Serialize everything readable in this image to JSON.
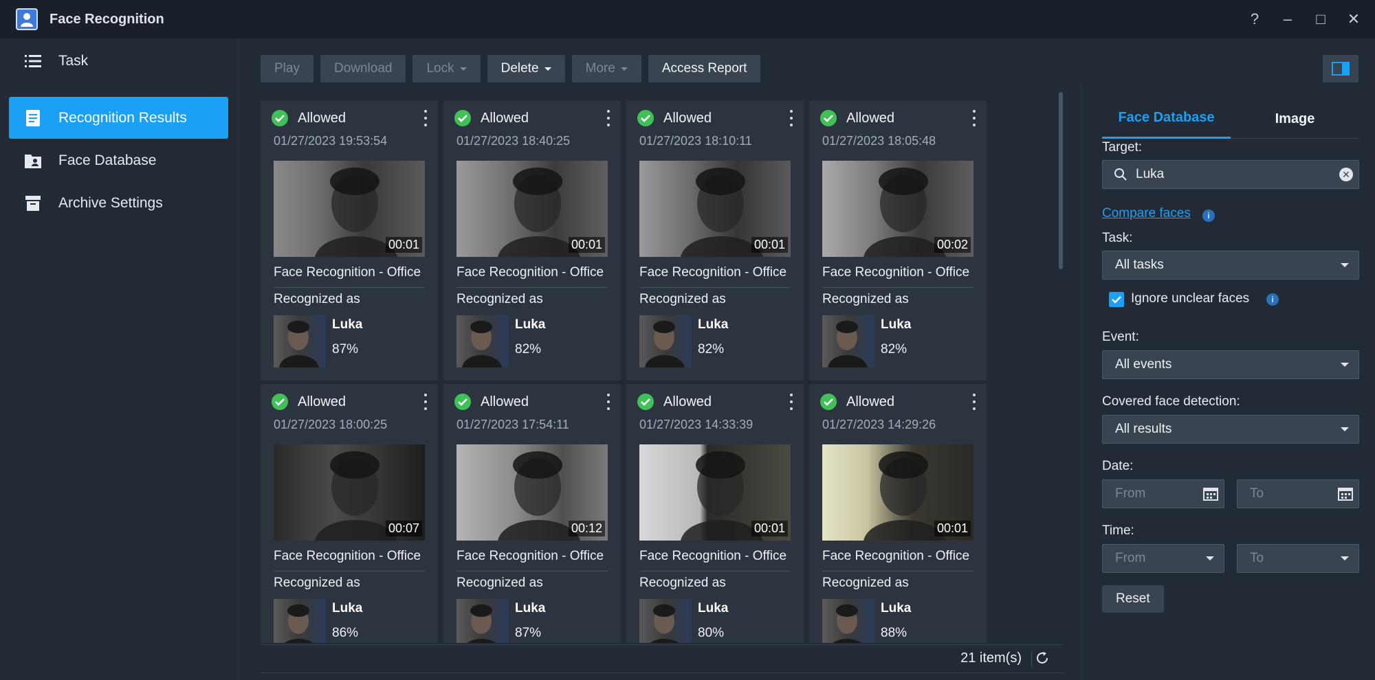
{
  "window": {
    "title": "Face Recognition",
    "controls": [
      "?",
      "–",
      "□",
      "✕"
    ]
  },
  "sidebar": {
    "items": [
      {
        "label": "Task",
        "icon": "list-icon",
        "active": false
      },
      {
        "label": "Recognition Results",
        "icon": "document-icon",
        "active": true
      },
      {
        "label": "Face Database",
        "icon": "folder-user-icon",
        "active": false
      },
      {
        "label": "Archive Settings",
        "icon": "archive-box-icon",
        "active": false
      }
    ]
  },
  "toolbar": {
    "play": "Play",
    "download": "Download",
    "lock": "Lock",
    "delete": "Delete",
    "more": "More",
    "access_report": "Access Report"
  },
  "results": [
    {
      "status": "Allowed",
      "time": "01/27/2023 19:53:54",
      "duration": "00:01",
      "task": "Face Recognition - Office",
      "recognized_label": "Recognized as",
      "name": "Luka",
      "score": "87%"
    },
    {
      "status": "Allowed",
      "time": "01/27/2023 18:40:25",
      "duration": "00:01",
      "task": "Face Recognition - Office",
      "recognized_label": "Recognized as",
      "name": "Luka",
      "score": "82%"
    },
    {
      "status": "Allowed",
      "time": "01/27/2023 18:10:11",
      "duration": "00:01",
      "task": "Face Recognition - Office",
      "recognized_label": "Recognized as",
      "name": "Luka",
      "score": "82%"
    },
    {
      "status": "Allowed",
      "time": "01/27/2023 18:05:48",
      "duration": "00:02",
      "task": "Face Recognition - Office",
      "recognized_label": "Recognized as",
      "name": "Luka",
      "score": "82%"
    },
    {
      "status": "Allowed",
      "time": "01/27/2023 18:00:25",
      "duration": "00:07",
      "task": "Face Recognition - Office",
      "recognized_label": "Recognized as",
      "name": "Luka",
      "score": "86%"
    },
    {
      "status": "Allowed",
      "time": "01/27/2023 17:54:11",
      "duration": "00:12",
      "task": "Face Recognition - Office",
      "recognized_label": "Recognized as",
      "name": "Luka",
      "score": "87%"
    },
    {
      "status": "Allowed",
      "time": "01/27/2023 14:33:39",
      "duration": "00:01",
      "task": "Face Recognition - Office",
      "recognized_label": "Recognized as",
      "name": "Luka",
      "score": "80%"
    },
    {
      "status": "Allowed",
      "time": "01/27/2023 14:29:26",
      "duration": "00:01",
      "task": "Face Recognition - Office",
      "recognized_label": "Recognized as",
      "name": "Luka",
      "score": "88%"
    }
  ],
  "footer": {
    "count": "21 item(s)"
  },
  "filters": {
    "tabs": [
      "Face Database",
      "Image"
    ],
    "target_label": "Target:",
    "target_value": "Luka",
    "compare_link": "Compare faces",
    "task_label": "Task:",
    "task_value": "All tasks",
    "ignore_unclear": "Ignore unclear faces",
    "event_label": "Event:",
    "event_value": "All events",
    "covered_label": "Covered face detection:",
    "covered_value": "All results",
    "date_label": "Date:",
    "date_from": "From",
    "date_to": "To",
    "time_label": "Time:",
    "time_from": "From",
    "time_to": "To",
    "reset": "Reset"
  },
  "colors": {
    "accent": "#1aa0f5",
    "allowed": "#40c057",
    "background": "#222a35",
    "card": "#2c3440"
  }
}
